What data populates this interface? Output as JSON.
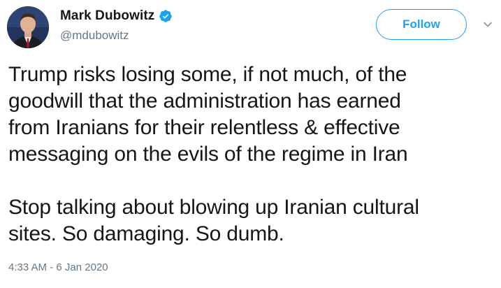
{
  "author": {
    "display_name": "Mark Dubowitz",
    "handle": "@mdubowitz",
    "verified": true
  },
  "actions": {
    "follow_label": "Follow"
  },
  "tweet": {
    "lines_para1": [
      "Trump risks losing some, if not much, of the",
      "goodwill that the administration has earned",
      "from Iranians for their relentless & effective",
      "messaging on the evils of the regime in Iran"
    ],
    "lines_para2": [
      "Stop talking about blowing up Iranian cultural",
      "sites. So damaging. So dumb."
    ],
    "timestamp": "4:33 AM - 6 Jan 2020"
  },
  "colors": {
    "accent": "#1da1f2",
    "text": "#14171a",
    "secondary": "#657786"
  }
}
